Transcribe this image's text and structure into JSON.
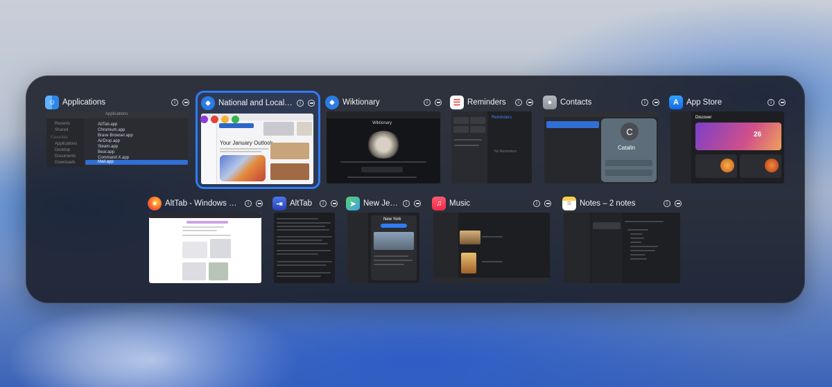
{
  "colors": {
    "accent": "#2f7cf6",
    "panel": "#161a24"
  },
  "windows": [
    {
      "title": "Applications",
      "icon": "finder-icon",
      "color": "#3a8ef0",
      "preview": {
        "header": "Applications",
        "sidebar": [
          "Recents",
          "Shared",
          "Favorites",
          "Applications",
          "Desktop",
          "Documents",
          "Downloads"
        ],
        "rows": [
          "AltTab.app",
          "Chromium.app",
          "Brave Browser.app",
          "AirDrop.app",
          "Steam.app",
          "Bear.app",
          "Command X.app",
          "Mail.app"
        ]
      }
    },
    {
      "title": "National and Local Weather Radar...",
      "icon": "safari-icon",
      "color": "#2b7be4",
      "preview": {
        "headline": "Your January Outlook"
      }
    },
    {
      "title": "Wiktionary",
      "icon": "safari-icon",
      "color": "#2b7be4",
      "preview": {
        "heading": "Wiktionary"
      }
    },
    {
      "title": "Reminders",
      "icon": "reminders-icon",
      "color": "#ffffff",
      "preview": {
        "list": "Reminders",
        "empty": "No Reminders"
      }
    },
    {
      "title": "Contacts",
      "icon": "contacts-icon",
      "color": "#9aa0a8",
      "preview": {
        "initial": "C",
        "name": "Catalin"
      }
    },
    {
      "title": "App Store",
      "icon": "appstore-icon",
      "color": "#1b8cf4",
      "preview": {
        "heading": "Discover",
        "badge": "26"
      }
    },
    {
      "title": "AltTab - Windows alt-tab on macOS",
      "icon": "firefox-icon",
      "color": "#ff7b22",
      "preview": {}
    },
    {
      "title": "AltTab",
      "icon": "alttab-icon",
      "color": "#3b5bd9",
      "preview": {}
    },
    {
      "title": "New Jersey",
      "icon": "maps-icon",
      "color": "#42b65a",
      "preview": {
        "place": "New York"
      }
    },
    {
      "title": "Music",
      "icon": "music-icon",
      "color": "#fb3b5a",
      "preview": {}
    },
    {
      "title": "Notes – 2 notes",
      "icon": "notes-icon",
      "color": "#f7d34a",
      "preview": {}
    }
  ]
}
